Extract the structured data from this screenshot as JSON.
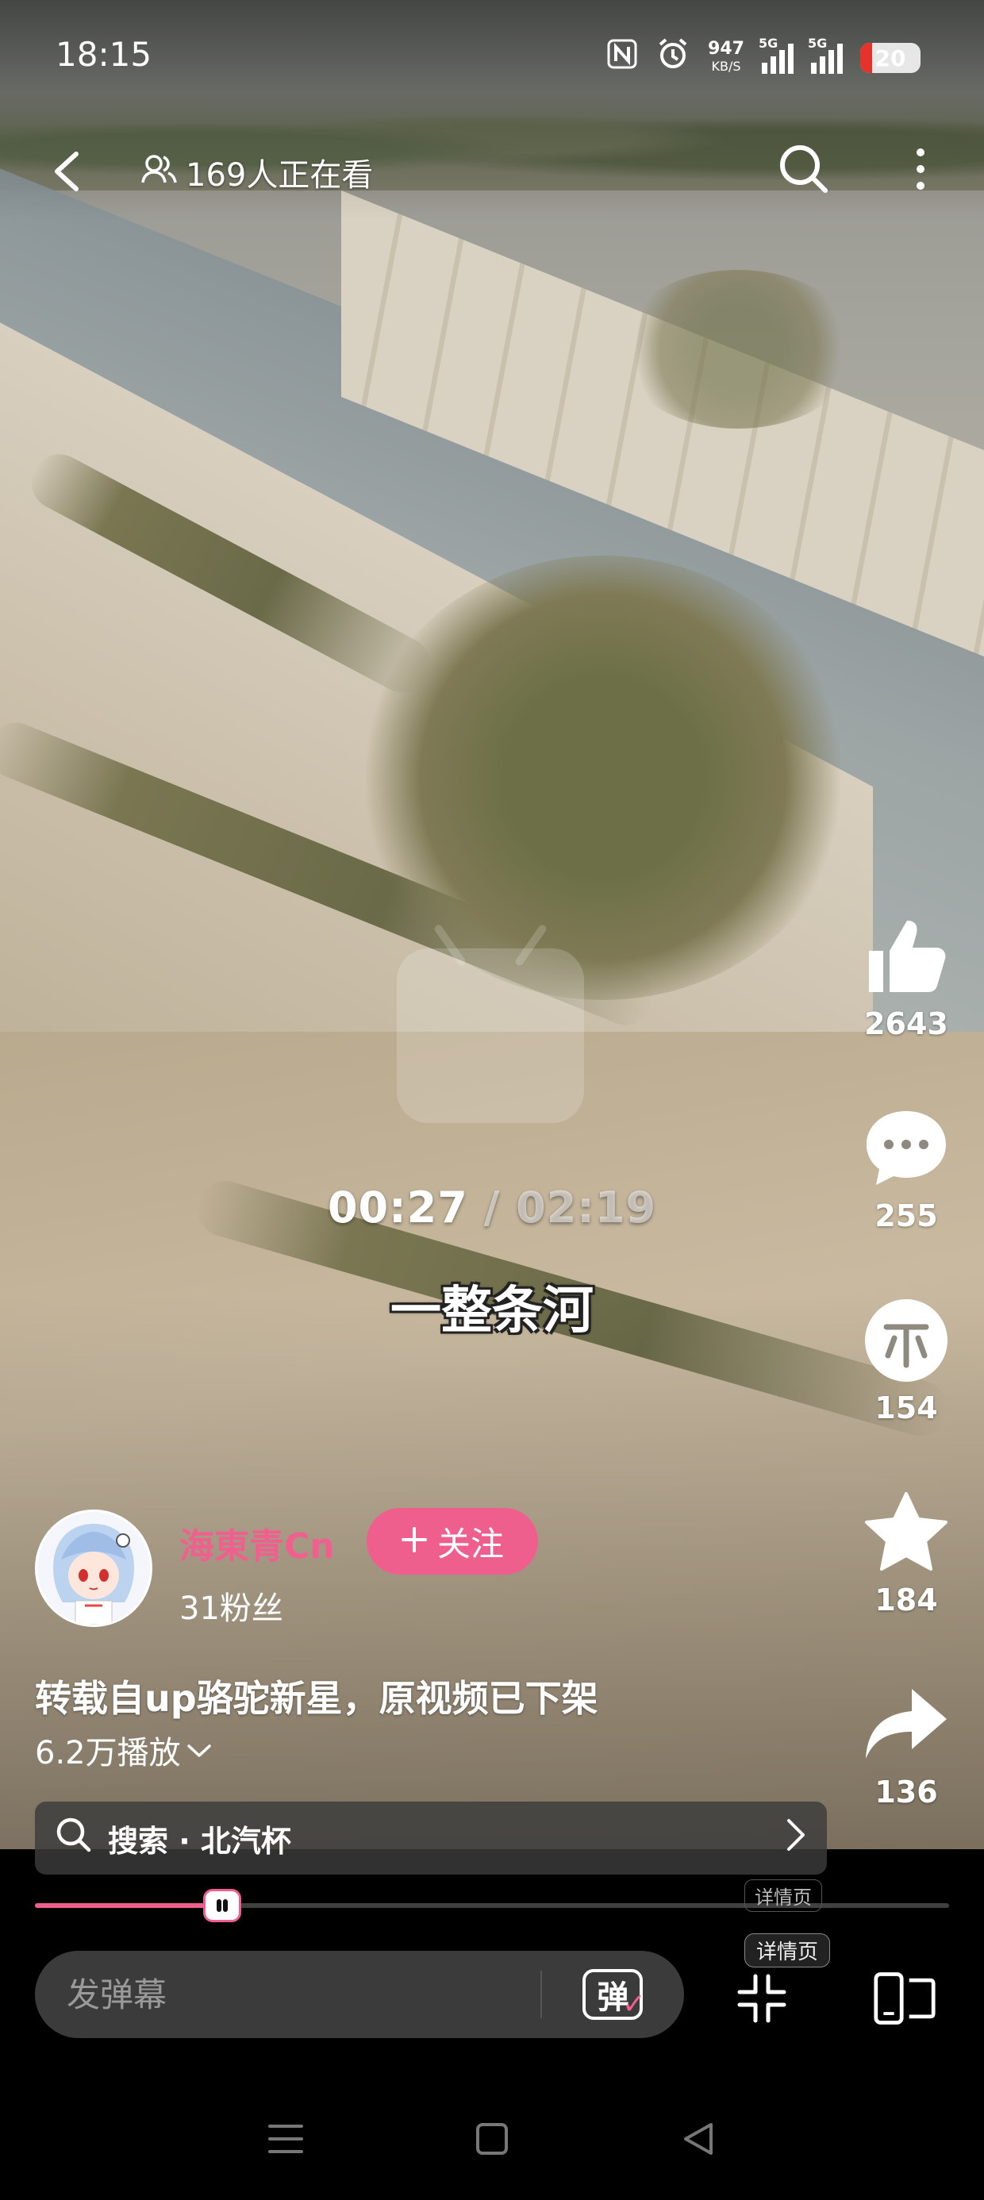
{
  "status_bar": {
    "time": "18:15",
    "net_speed": "947",
    "net_unit": "KB/S",
    "signal1": "5G",
    "signal2": "5G",
    "battery": "20"
  },
  "top_bar": {
    "viewers": "169人正在看"
  },
  "player": {
    "current_time": "00:27",
    "separator": " / ",
    "total_time": "02:19",
    "subtitle": "一整条河",
    "progress_percent": 20.5
  },
  "actions": {
    "like_count": "2643",
    "comment_count": "255",
    "coin_count": "154",
    "favorite_count": "184",
    "share_count": "136"
  },
  "author": {
    "name": "海東青Cn",
    "follow_label": "关注",
    "fans": "31粉丝"
  },
  "video": {
    "title": "转载自up骆驼新星，原视频已下架",
    "plays": "6.2万播放"
  },
  "search": {
    "label": "搜索 · 北汽杯"
  },
  "detail": {
    "label": "详情页"
  },
  "bottom": {
    "danmaku_placeholder": "发弹幕",
    "danmaku_toggle": "弹"
  },
  "colors": {
    "accent": "#ef5f8e",
    "bar_bg": "#3b3b3b"
  },
  "icons": [
    "back-icon",
    "viewers-icon",
    "search-icon",
    "more-icon",
    "like-icon",
    "comment-icon",
    "coin-icon",
    "favorite-icon",
    "share-icon",
    "chevron-right-icon",
    "fullscreen-exit-icon",
    "screen-switch-icon",
    "menu-icon",
    "home-icon",
    "back-nav-icon"
  ]
}
